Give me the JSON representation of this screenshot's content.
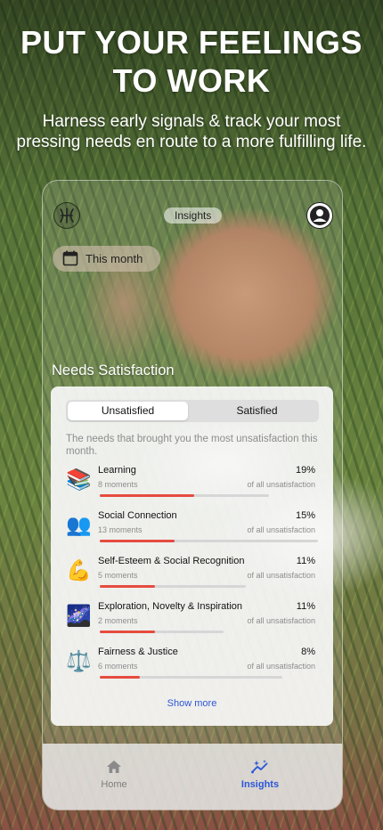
{
  "hero": {
    "title_line1": "PUT YOUR FEELINGS",
    "title_line2": "TO WORK",
    "subtitle_line1": "Harness early signals & track your most",
    "subtitle_line2": "pressing needs en route to a more fulfilling life."
  },
  "app": {
    "header_title": "Insights",
    "period": "This month",
    "section_title": "Needs Satisfaction",
    "tabs": {
      "unsatisfied": "Unsatisfied",
      "satisfied": "Satisfied"
    },
    "description": "The needs that brought you the most unsatisfaction this month.",
    "needs": [
      {
        "name": "Learning",
        "moments": "8 moments",
        "percent": "19%",
        "of": "of all unsatisfaction",
        "icon": "books-icon",
        "fill": 0.19
      },
      {
        "name": "Social Connection",
        "moments": "13 moments",
        "percent": "15%",
        "of": "of all unsatisfaction",
        "icon": "people-icon",
        "fill": 0.15
      },
      {
        "name": "Self-Esteem & Social Recognition",
        "moments": "5 moments",
        "percent": "11%",
        "of": "of all unsatisfaction",
        "icon": "flexed-biceps-icon",
        "fill": 0.11
      },
      {
        "name": "Exploration, Novelty & Inspiration",
        "moments": "2 moments",
        "percent": "11%",
        "of": "of all unsatisfaction",
        "icon": "milky-way-icon",
        "fill": 0.11
      },
      {
        "name": "Fairness & Justice",
        "moments": "6 moments",
        "percent": "8%",
        "of": "of all unsatisfaction",
        "icon": "balance-scale-icon",
        "fill": 0.08
      }
    ],
    "show_more": "Show more",
    "nav": {
      "home": "Home",
      "insights": "Insights"
    },
    "colors": {
      "accent": "#2b56d9",
      "bar_fill": "#e64b3f"
    }
  }
}
